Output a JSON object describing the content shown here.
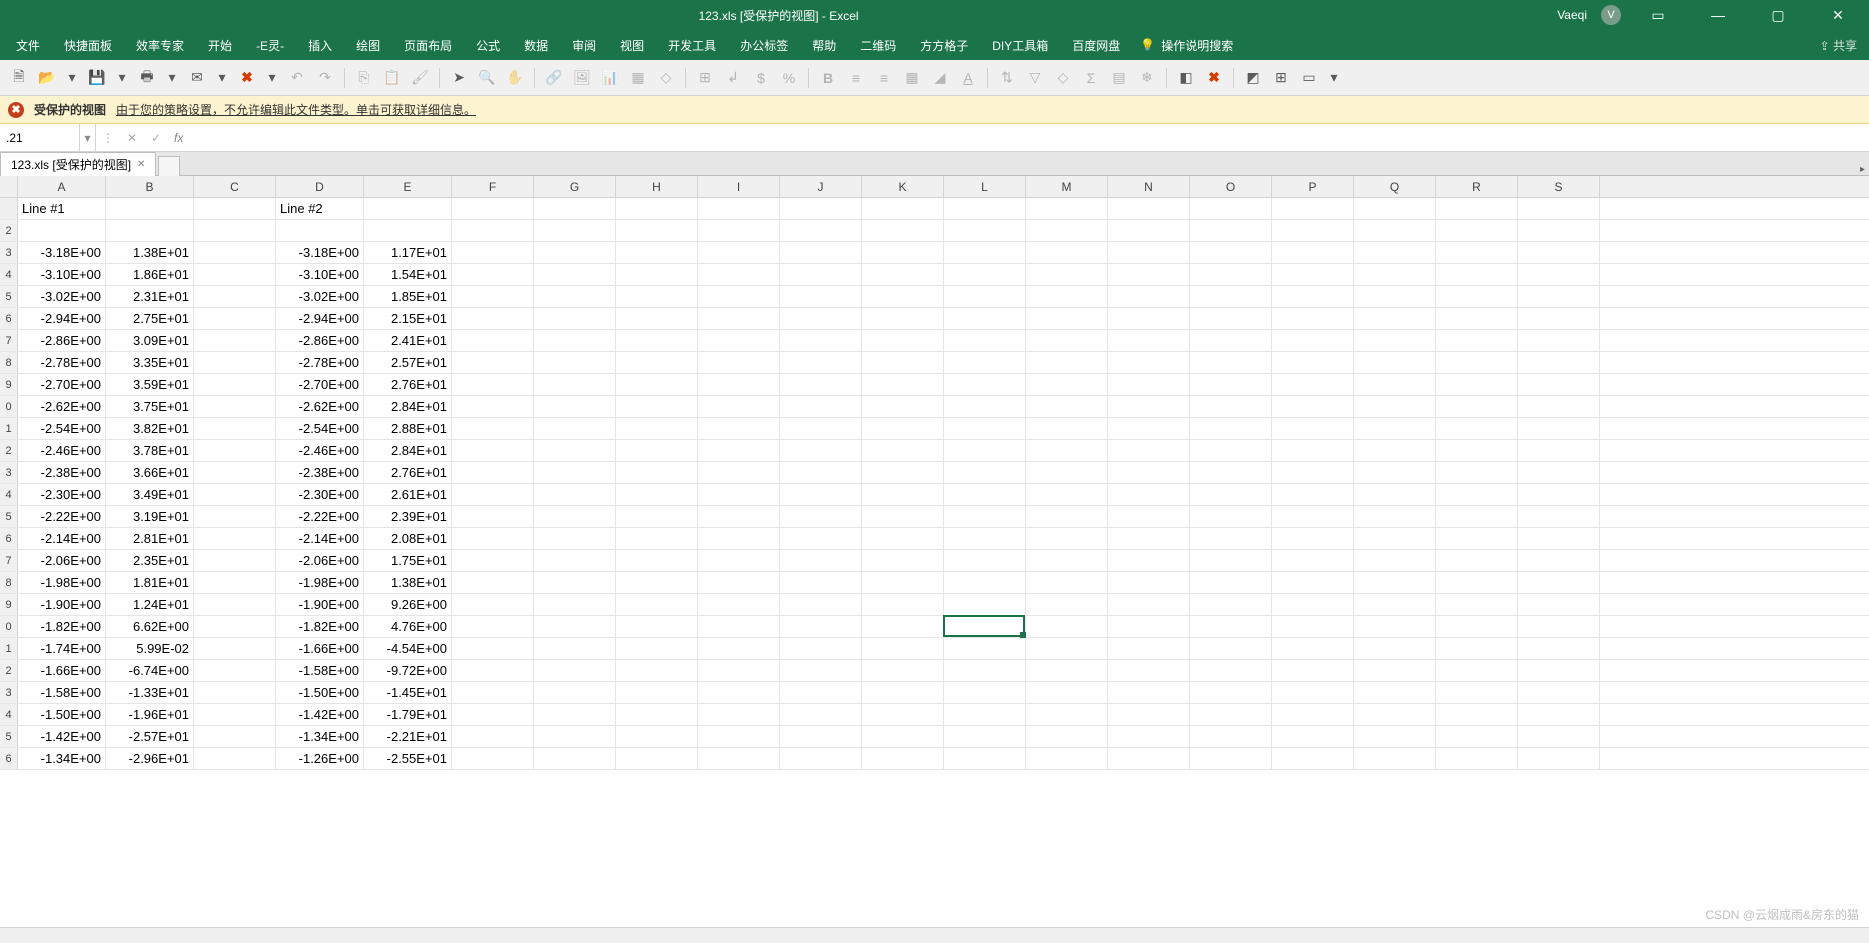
{
  "title_center": "123.xls  [受保护的视图]  -  Excel",
  "user": {
    "name": "Vaeqi",
    "initial": "V"
  },
  "ribbon_tabs": [
    "文件",
    "快捷面板",
    "效率专家",
    "开始",
    "-E灵-",
    "插入",
    "绘图",
    "页面布局",
    "公式",
    "数据",
    "审阅",
    "视图",
    "开发工具",
    "办公标签",
    "帮助",
    "二维码",
    "方方格子",
    "DIY工具箱",
    "百度网盘"
  ],
  "tellme_label": "操作说明搜索",
  "share_label": "共享",
  "warning": {
    "title": "受保护的视图",
    "link": "由于您的策略设置，不允许编辑此文件类型。单击可获取详细信息。"
  },
  "namebox_value": ".21",
  "sheet_tab": "123.xls  [受保护的视图]",
  "columns": [
    "A",
    "B",
    "C",
    "D",
    "E",
    "F",
    "G",
    "H",
    "I",
    "J",
    "K",
    "L",
    "M",
    "N",
    "O",
    "P",
    "Q",
    "R",
    "S"
  ],
  "row_numbers": [
    "",
    "2",
    "3",
    "4",
    "5",
    "6",
    "7",
    "8",
    "9",
    "0",
    "1",
    "2",
    "3",
    "4",
    "5",
    "6",
    "7",
    "8",
    "9",
    "0",
    "1",
    "2",
    "3",
    "4",
    "5",
    "6"
  ],
  "active_cell": {
    "col": "L",
    "row": 21
  },
  "headers": {
    "A": "Line #1",
    "D": "Line #2"
  },
  "data_rows": [
    {
      "A": "-3.18E+00",
      "B": "1.38E+01",
      "D": "-3.18E+00",
      "E": "1.17E+01"
    },
    {
      "A": "-3.10E+00",
      "B": "1.86E+01",
      "D": "-3.10E+00",
      "E": "1.54E+01"
    },
    {
      "A": "-3.02E+00",
      "B": "2.31E+01",
      "D": "-3.02E+00",
      "E": "1.85E+01"
    },
    {
      "A": "-2.94E+00",
      "B": "2.75E+01",
      "D": "-2.94E+00",
      "E": "2.15E+01"
    },
    {
      "A": "-2.86E+00",
      "B": "3.09E+01",
      "D": "-2.86E+00",
      "E": "2.41E+01"
    },
    {
      "A": "-2.78E+00",
      "B": "3.35E+01",
      "D": "-2.78E+00",
      "E": "2.57E+01"
    },
    {
      "A": "-2.70E+00",
      "B": "3.59E+01",
      "D": "-2.70E+00",
      "E": "2.76E+01"
    },
    {
      "A": "-2.62E+00",
      "B": "3.75E+01",
      "D": "-2.62E+00",
      "E": "2.84E+01"
    },
    {
      "A": "-2.54E+00",
      "B": "3.82E+01",
      "D": "-2.54E+00",
      "E": "2.88E+01"
    },
    {
      "A": "-2.46E+00",
      "B": "3.78E+01",
      "D": "-2.46E+00",
      "E": "2.84E+01"
    },
    {
      "A": "-2.38E+00",
      "B": "3.66E+01",
      "D": "-2.38E+00",
      "E": "2.76E+01"
    },
    {
      "A": "-2.30E+00",
      "B": "3.49E+01",
      "D": "-2.30E+00",
      "E": "2.61E+01"
    },
    {
      "A": "-2.22E+00",
      "B": "3.19E+01",
      "D": "-2.22E+00",
      "E": "2.39E+01"
    },
    {
      "A": "-2.14E+00",
      "B": "2.81E+01",
      "D": "-2.14E+00",
      "E": "2.08E+01"
    },
    {
      "A": "-2.06E+00",
      "B": "2.35E+01",
      "D": "-2.06E+00",
      "E": "1.75E+01"
    },
    {
      "A": "-1.98E+00",
      "B": "1.81E+01",
      "D": "-1.98E+00",
      "E": "1.38E+01"
    },
    {
      "A": "-1.90E+00",
      "B": "1.24E+01",
      "D": "-1.90E+00",
      "E": "9.26E+00"
    },
    {
      "A": "-1.82E+00",
      "B": "6.62E+00",
      "D": "-1.82E+00",
      "E": "4.76E+00"
    },
    {
      "A": "-1.74E+00",
      "B": "5.99E-02",
      "D": "-1.66E+00",
      "E": "-4.54E+00"
    },
    {
      "A": "-1.66E+00",
      "B": "-6.74E+00",
      "D": "-1.58E+00",
      "E": "-9.72E+00"
    },
    {
      "A": "-1.58E+00",
      "B": "-1.33E+01",
      "D": "-1.50E+00",
      "E": "-1.45E+01"
    },
    {
      "A": "-1.50E+00",
      "B": "-1.96E+01",
      "D": "-1.42E+00",
      "E": "-1.79E+01"
    },
    {
      "A": "-1.42E+00",
      "B": "-2.57E+01",
      "D": "-1.34E+00",
      "E": "-2.21E+01"
    },
    {
      "A": "-1.34E+00",
      "B": "-2.96E+01",
      "D": "-1.26E+00",
      "E": "-2.55E+01"
    }
  ],
  "watermark": "CSDN @云烟成雨&房东的猫"
}
